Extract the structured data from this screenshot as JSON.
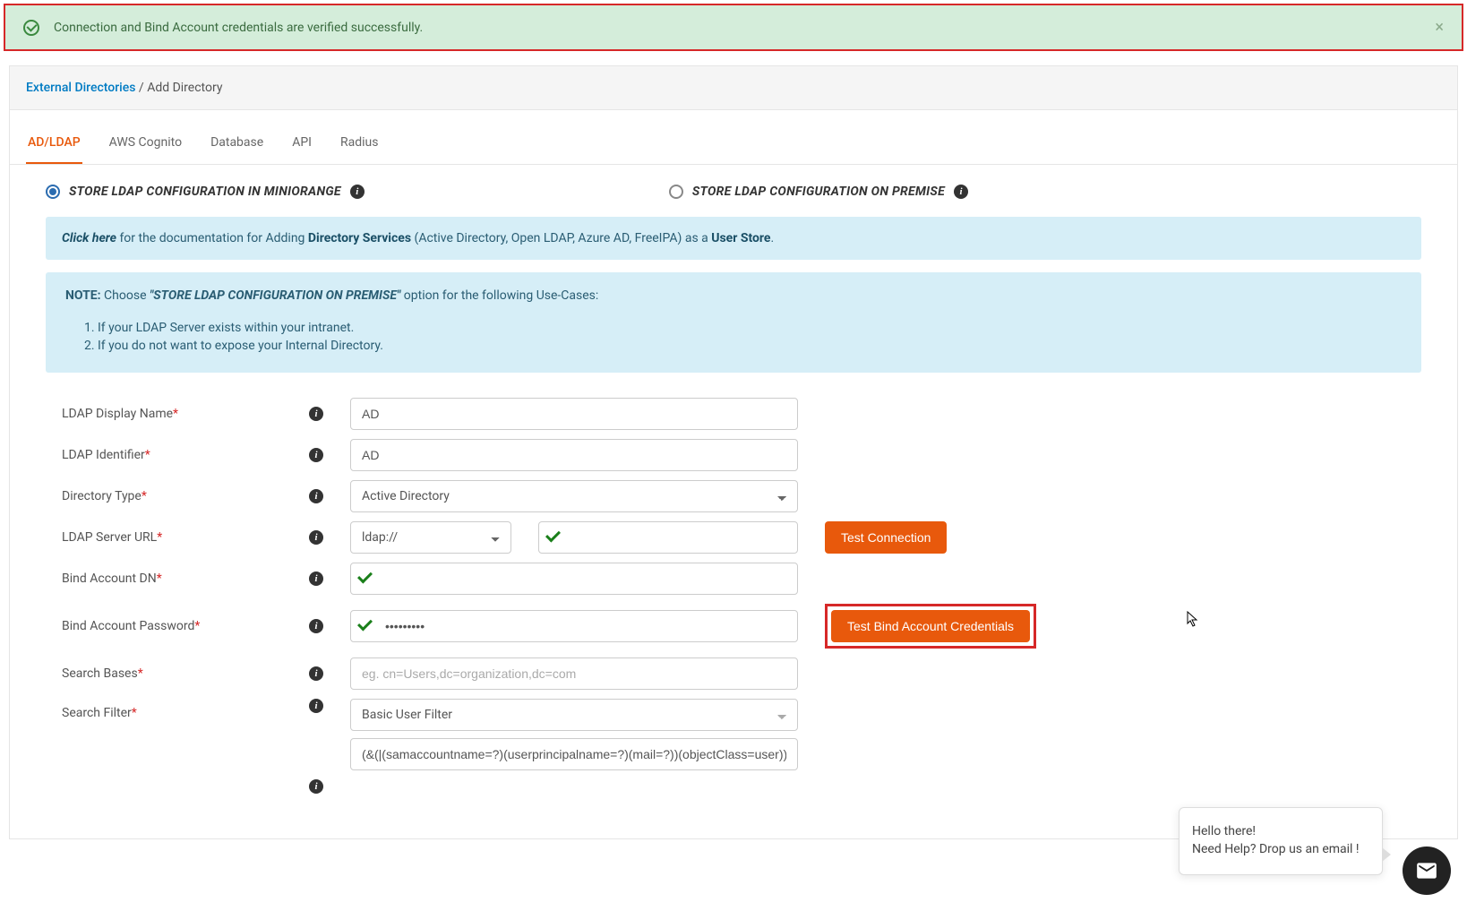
{
  "alert": {
    "message": "Connection and Bind Account credentials are verified successfully."
  },
  "breadcrumb": {
    "link": "External Directories",
    "sep": " / ",
    "current": "Add Directory"
  },
  "tabs": [
    "AD/LDAP",
    "AWS Cognito",
    "Database",
    "API",
    "Radius"
  ],
  "radio": {
    "opt1": "STORE LDAP CONFIGURATION IN MINIORANGE",
    "opt2": "STORE LDAP CONFIGURATION ON PREMISE"
  },
  "docbox": {
    "click": "Click here",
    "text1": " for the documentation for Adding ",
    "bold1": "Directory Services",
    "text2": " (Active Directory, Open LDAP, Azure AD, FreeIPA) as a ",
    "bold2": "User Store",
    "tail": "."
  },
  "notebox": {
    "label": "NOTE:",
    "lead": "  Choose ",
    "quote": "\"STORE LDAP CONFIGURATION ON PREMISE\"",
    "tail": " option for the following Use-Cases:",
    "items": [
      "If your LDAP Server exists within your intranet.",
      "If you do not want to expose your Internal Directory."
    ]
  },
  "form": {
    "displayName": {
      "label": "LDAP Display Name",
      "value": "AD"
    },
    "identifier": {
      "label": "LDAP Identifier",
      "value": "AD"
    },
    "dirType": {
      "label": "Directory Type",
      "value": "Active Directory"
    },
    "serverUrl": {
      "label": "LDAP Server URL",
      "protocol": "ldap://",
      "host": " "
    },
    "bindDn": {
      "label": "Bind Account DN",
      "value": " "
    },
    "bindPw": {
      "label": "Bind Account Password",
      "value": "•••••••••"
    },
    "searchBases": {
      "label": "Search Bases",
      "placeholder": "eg. cn=Users,dc=organization,dc=com"
    },
    "searchFilter": {
      "label": "Search Filter",
      "value": "Basic User Filter",
      "filterString": "(&(|(samaccountname=?)(userprincipalname=?)(mail=?))(objectClass=user))"
    }
  },
  "buttons": {
    "testConn": "Test Connection",
    "testBind": "Test Bind Account Credentials"
  },
  "chat": {
    "line1": "Hello there!",
    "line2": "Need Help? Drop us an email !"
  }
}
